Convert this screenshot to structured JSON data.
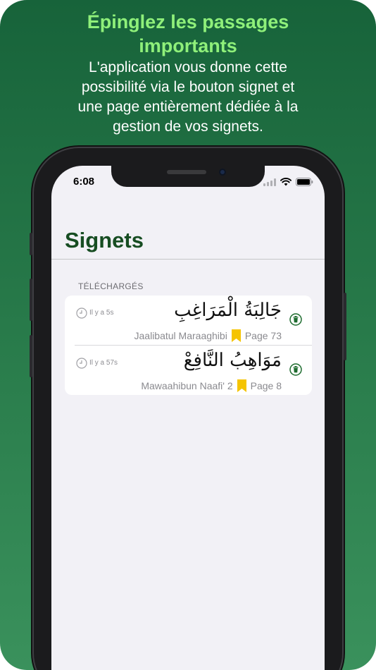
{
  "headline": {
    "line1": "Épinglez les passages",
    "line2": "importants"
  },
  "subline": {
    "line1": "L'application vous donne cette",
    "line2": "possibilité via le bouton signet et",
    "line3": "une page entièrement dédiée à la",
    "line4": "gestion de vos signets."
  },
  "status_bar": {
    "time": "6:08"
  },
  "nav": {
    "title": "Signets"
  },
  "section": {
    "header": "TÉLÉCHARGÉS"
  },
  "bookmarks": [
    {
      "time_ago": "Il y a 5s",
      "arabic_title": "جَالِبَةُ الْمَرَاغِبِ",
      "transliteration": "Jaalibatul Maraaghibi",
      "page": "Page 73"
    },
    {
      "time_ago": "Il y a 57s",
      "arabic_title": "مَوَاهِبُ النَّافِعْ",
      "transliteration": "Mawaahibun Naafi' 2",
      "page": "Page 8"
    }
  ],
  "colors": {
    "headline": "#8ff07a",
    "title_green": "#174d22",
    "bookmark_yellow": "#f5c400",
    "trash_green": "#1d6b2e"
  }
}
